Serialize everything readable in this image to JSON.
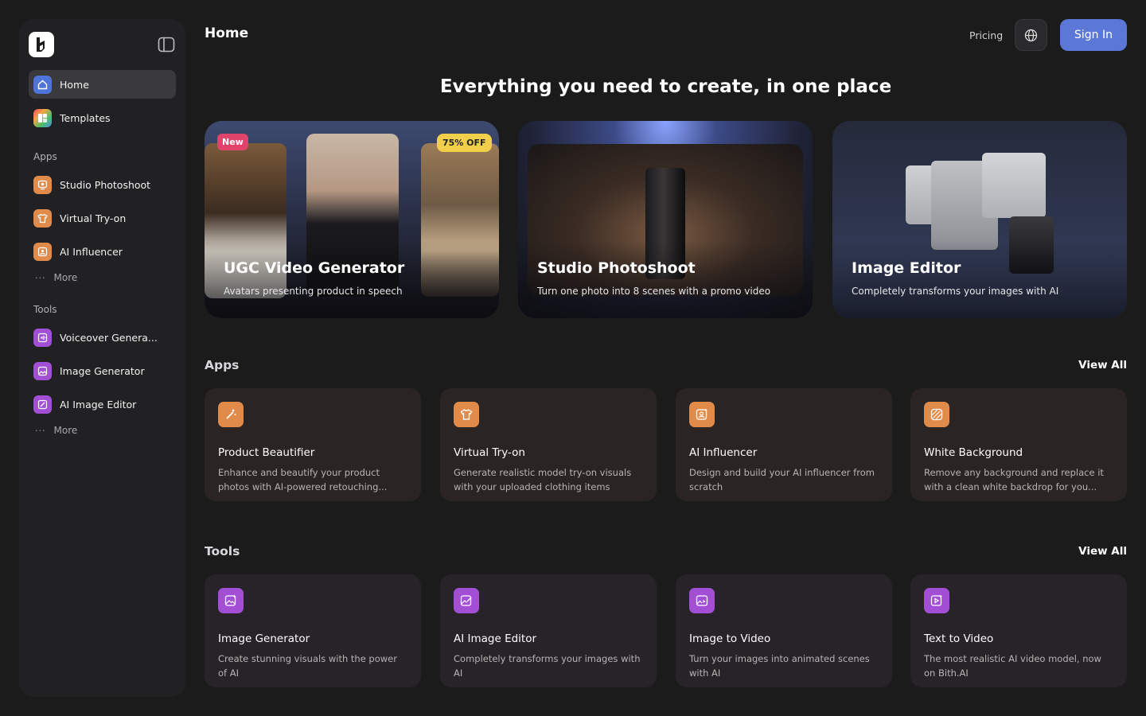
{
  "header": {
    "title": "Home",
    "pricing": "Pricing",
    "sign_in": "Sign In"
  },
  "sidebar": {
    "home": "Home",
    "templates": "Templates",
    "apps_label": "Apps",
    "apps": [
      "Studio Photoshoot",
      "Virtual Try-on",
      "AI Influencer"
    ],
    "apps_more": "More",
    "tools_label": "Tools",
    "tools": [
      "Voiceover Genera...",
      "Image Generator",
      "AI Image Editor"
    ],
    "tools_more": "More"
  },
  "hero": {
    "headline": "Everything you need to create, in one place"
  },
  "features": [
    {
      "title": "UGC Video Generator",
      "subtitle": "Avatars presenting product in speech",
      "badge_new": "New",
      "badge_offer": "75% OFF"
    },
    {
      "title": "Studio Photoshoot",
      "subtitle": "Turn one photo into 8 scenes with a promo video"
    },
    {
      "title": "Image Editor",
      "subtitle": "Completely transforms your images with AI"
    }
  ],
  "apps_section": {
    "title": "Apps",
    "view_all": "View All",
    "cards": [
      {
        "title": "Product Beautifier",
        "desc": "Enhance and beautify your product photos with AI-powered retouching...",
        "icon": "magic-wand-icon"
      },
      {
        "title": "Virtual Try-on",
        "desc": "Generate realistic model try-on visuals with your uploaded clothing items",
        "icon": "shirt-icon"
      },
      {
        "title": "AI Influencer",
        "desc": "Design and build your AI influencer from scratch",
        "icon": "person-sparkle-icon"
      },
      {
        "title": "White Background",
        "desc": "Remove any background and replace it with a clean white backdrop for you...",
        "icon": "hatched-square-icon"
      }
    ]
  },
  "tools_section": {
    "title": "Tools",
    "view_all": "View All",
    "cards": [
      {
        "title": "Image Generator",
        "desc": "Create stunning visuals with the power of AI",
        "icon": "image-sparkle-icon"
      },
      {
        "title": "AI Image Editor",
        "desc": "Completely transforms your images with AI",
        "icon": "image-edit-icon"
      },
      {
        "title": "Image to Video",
        "desc": "Turn your images into animated scenes with AI",
        "icon": "image-video-icon"
      },
      {
        "title": "Text to Video",
        "desc": "The most realistic AI video model, now on Bith.AI",
        "icon": "play-sparkle-icon"
      }
    ]
  },
  "colors": {
    "accent": "#5b78d6",
    "app_icon": "#e08b4a",
    "tool_icon": "#a24fd6",
    "badge_new": "#e0446a",
    "badge_offer": "#f2cf4a"
  }
}
